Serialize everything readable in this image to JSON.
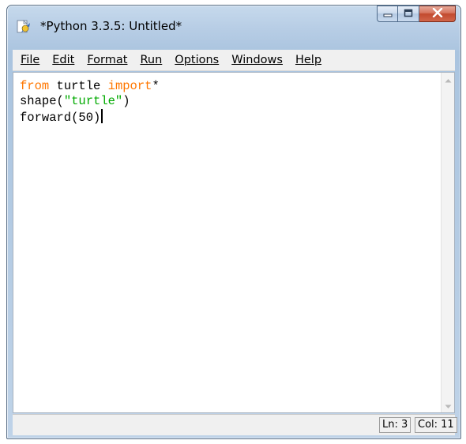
{
  "window": {
    "title": "*Python 3.3.5: Untitled*",
    "app_icon": "python-idle-icon"
  },
  "caption_buttons": {
    "minimize_icon": "minimize-icon",
    "maximize_icon": "maximize-icon",
    "close_icon": "close-icon",
    "close_color": "#c24a2e"
  },
  "menu": {
    "items": [
      {
        "label": "File"
      },
      {
        "label": "Edit"
      },
      {
        "label": "Format"
      },
      {
        "label": "Run"
      },
      {
        "label": "Options"
      },
      {
        "label": "Windows"
      },
      {
        "label": "Help"
      }
    ]
  },
  "editor": {
    "lines": [
      [
        {
          "t": "from",
          "c": "kw"
        },
        {
          "t": " turtle ",
          "c": ""
        },
        {
          "t": "import",
          "c": "kw"
        },
        {
          "t": "*",
          "c": ""
        }
      ],
      [
        {
          "t": "shape(",
          "c": ""
        },
        {
          "t": "\"turtle\"",
          "c": "str"
        },
        {
          "t": ")",
          "c": ""
        }
      ],
      [
        {
          "t": "forward(50)",
          "c": ""
        }
      ]
    ],
    "colors": {
      "keyword": "#ff7700",
      "string": "#00aa00",
      "text": "#000000"
    },
    "scroll_up_icon": "scroll-up-arrow-icon",
    "scroll_down_icon": "scroll-down-arrow-icon"
  },
  "status": {
    "line": "Ln: 3",
    "column": "Col: 11"
  }
}
